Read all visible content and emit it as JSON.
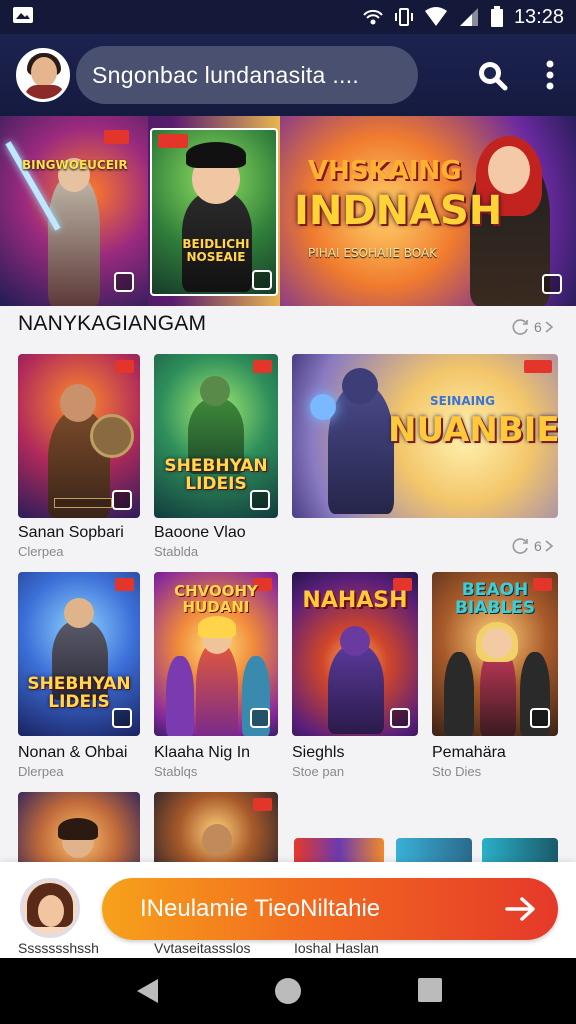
{
  "status_bar": {
    "time": "13:28"
  },
  "header": {
    "search_text": "Sngonbac lundanasita ....",
    "avatar_icon": "user-avatar-icon",
    "search_icon": "search-icon",
    "menu_icon": "more-vertical-icon"
  },
  "hero": {
    "panel1_caption": "BINGWOEUCEIR",
    "panel2_caption": "BEIDLICHI NOSEAIE",
    "panel3_title_top": "VHSKAING",
    "panel3_title_main": "INDNASH",
    "panel3_subtitle": "PIHAI ESOHAIIE BOAK"
  },
  "section": {
    "title": "NANYKAGIANGAM",
    "see_more_1": "6",
    "see_more_2": "6"
  },
  "row1": [
    {
      "title": "Sanan Sopbari",
      "subtitle": "Clerpea"
    },
    {
      "title": "Baoone Vlao",
      "subtitle": "Stablda",
      "logo": "SHEBHYAN LIDEIS"
    },
    {
      "title": "",
      "subtitle": "",
      "logo": "NUANBIES",
      "logo_top": "SEINAING"
    }
  ],
  "row2": [
    {
      "title": "Nonan & Ohbai",
      "subtitle": "Dlerpea",
      "logo": "SHEBHYAN LIDEIS"
    },
    {
      "title": "Klaaha Nig In",
      "subtitle": "Stablqs",
      "logo": "CHVOOHY HUDANI"
    },
    {
      "title": "Sieghls",
      "subtitle": "Stoe pan",
      "logo": "NAHASH"
    },
    {
      "title": "Pemahära",
      "subtitle": "Sto Dies",
      "logo": "BEAOH BIABLES"
    }
  ],
  "bottom": {
    "cta_label": "INeulamie TieoNiltahie",
    "cta_icon": "arrow-right-icon",
    "peek_labels": [
      "Ssssssshssh",
      "Vvtaseitassslos",
      "Ioshal Haslan"
    ]
  },
  "nav": {
    "back_icon": "back-triangle-icon",
    "home_icon": "home-circle-icon",
    "recents_icon": "recents-square-icon"
  },
  "colors": {
    "appbar_bg": "#1c2350",
    "cta_start": "#f7a21b",
    "cta_end": "#e5392a",
    "tag_red": "#e4352a"
  }
}
